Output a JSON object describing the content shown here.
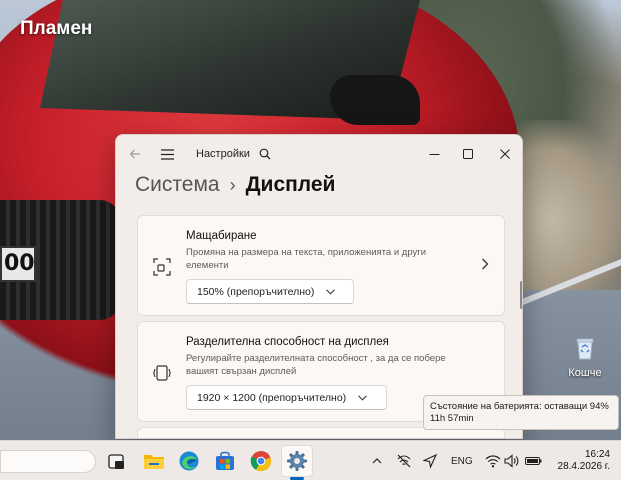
{
  "desktop": {
    "user_name": "Пламен",
    "license_plate_fragment": "00",
    "recycle_bin_label": "Кошче"
  },
  "window": {
    "app_title": "Настройки",
    "breadcrumb": {
      "parent": "Система",
      "separator": "›",
      "current": "Дисплей"
    },
    "cards": [
      {
        "title": "Мащабиране",
        "description": "Промяна на размера на текста, приложенията и други елементи",
        "dropdown_value": "150% (препоръчително)",
        "has_chevron": true
      },
      {
        "title": "Разделителна способност на дисплея",
        "description": "Регулирайте разделителната способност , за да се побере вашият свързан дисплей",
        "dropdown_value": "1920 × 1200 (препоръчително)"
      }
    ]
  },
  "tooltip": {
    "line1": "Състояние на батерията: оставащи 94%",
    "line2": "11h 57min"
  },
  "taskbar": {
    "language": "ENG",
    "time": "16:24",
    "date": "28.4.2026 г."
  },
  "colors": {
    "accent": "#0067c0",
    "window_bg": "#f3ede9",
    "card_bg": "#fbf8f6",
    "taskbar_bg": "#eee9e6"
  }
}
